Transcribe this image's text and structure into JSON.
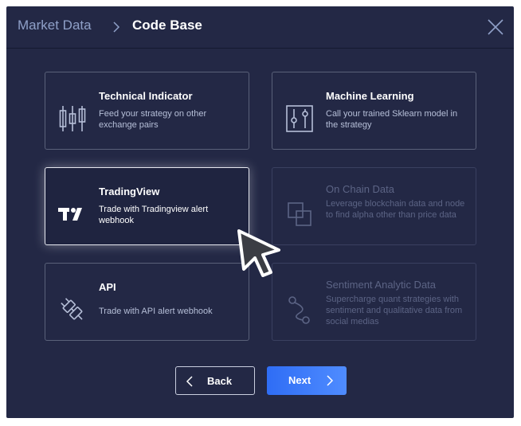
{
  "header": {
    "breadcrumb_parent": "Market Data",
    "breadcrumb_current": "Code Base"
  },
  "cards": [
    {
      "title": "Technical Indicator",
      "description": "Feed your strategy on other exchange pairs",
      "icon": "candlestick-icon",
      "state": "normal"
    },
    {
      "title": "Machine Learning",
      "description": "Call your trained Sklearn model in the strategy",
      "icon": "sliders-icon",
      "state": "normal"
    },
    {
      "title": "TradingView",
      "description": "Trade with Tradingview alert webhook",
      "icon": "tradingview-logo-icon",
      "state": "selected"
    },
    {
      "title": "On Chain Data",
      "description": "Leverage blockchain data and node to find alpha other than price data",
      "icon": "overlapping-squares-icon",
      "state": "disabled"
    },
    {
      "title": "API",
      "description": "Trade with API alert webhook",
      "icon": "plug-icon",
      "state": "normal"
    },
    {
      "title": "Sentiment Analytic Data",
      "description": "Supercharge quant strategies with sentiment and qualitative data from social medias",
      "icon": "path-nodes-icon",
      "state": "disabled"
    }
  ],
  "footer": {
    "back_label": "Back",
    "next_label": "Next"
  },
  "colors": {
    "modal_bg": "#232845",
    "accent": "#3a7bff",
    "muted": "#5c6485"
  }
}
